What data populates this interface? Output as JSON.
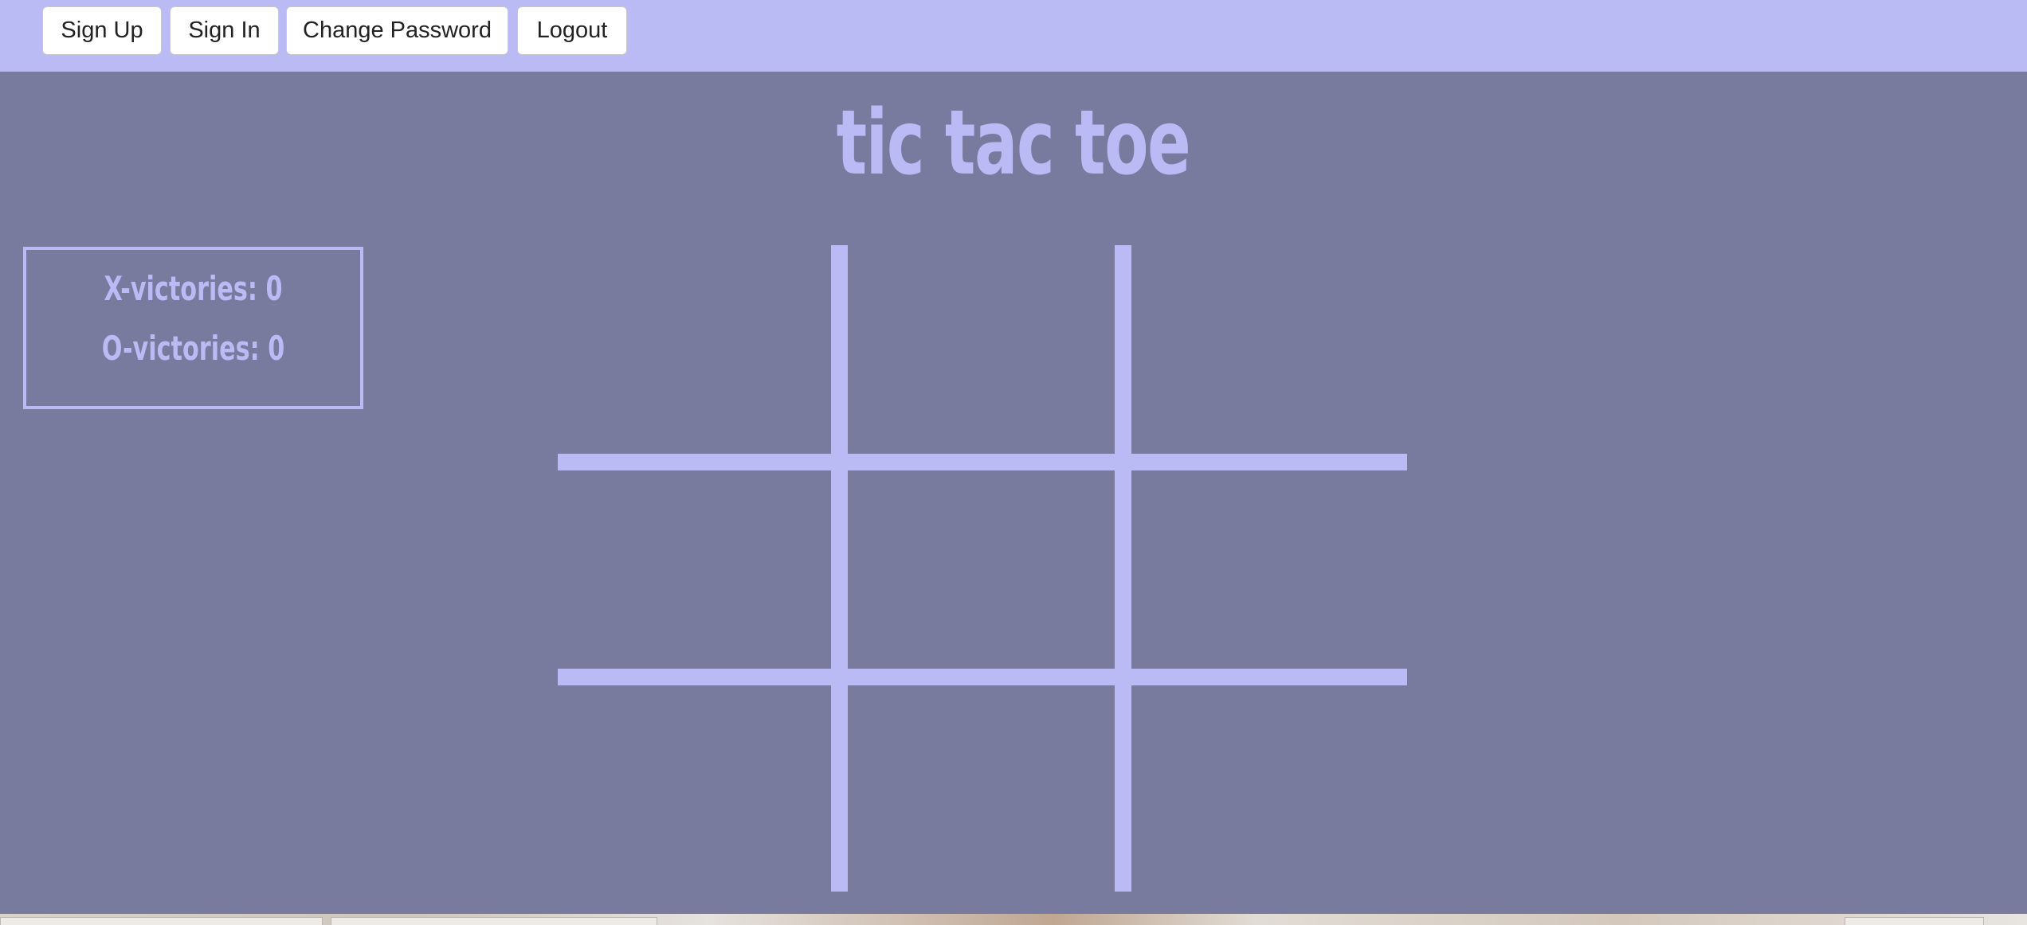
{
  "nav": {
    "signup_label": "Sign Up",
    "signin_label": "Sign In",
    "change_password_label": "Change Password",
    "logout_label": "Logout"
  },
  "game": {
    "title": "tic tac toe",
    "x_victories_label": "X-victories: ",
    "x_victories": "0",
    "o_victories_label": "O-victories: ",
    "o_victories": "0",
    "board": [
      "",
      "",
      "",
      "",
      "",
      "",
      "",
      "",
      ""
    ]
  },
  "colors": {
    "background": "#787a9e",
    "accent": "#babbf5",
    "button_bg": "#ffffff"
  }
}
